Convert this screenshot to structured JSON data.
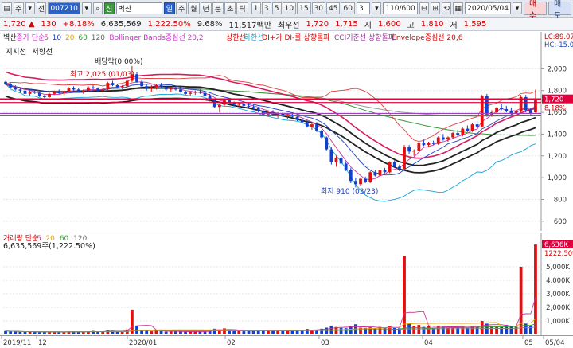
{
  "toolbar": {
    "type_label": "주",
    "mode_label": "전",
    "code": "007210",
    "search_badge": "신",
    "stock_name": "벽산",
    "period_buttons": [
      "일",
      "주",
      "월",
      "년",
      "분",
      "초",
      "틱"
    ],
    "selected_period": "일",
    "minute_buttons": [
      "1",
      "3",
      "5",
      "10",
      "15",
      "30",
      "45",
      "60"
    ],
    "custom_value": "3",
    "count": "110/600",
    "date": "2020/05/04",
    "buy_label": "매수",
    "sell_label": "매도"
  },
  "quote": {
    "price": "1,720",
    "change": "130",
    "change_pct": "+8.18%",
    "volume": "6,635,569",
    "vol_pct": "1,222.50%",
    "turnover_pct": "9.68%",
    "amount": "11,517백만",
    "best_label": "최우선",
    "best_price": "1,720",
    "best_price2": "1,715",
    "high_label": "시",
    "high": "1,600",
    "high2_label": "고",
    "high2": "1,810",
    "low_label": "저",
    "low": "1,595"
  },
  "price_legend": [
    {
      "text": "벽산",
      "color": "#222222"
    },
    {
      "text": "종가 단순",
      "color": "#cc33cc"
    },
    {
      "text": "5",
      "color": "#cc3399"
    },
    {
      "text": "10",
      "color": "#1d3fbf"
    },
    {
      "text": "20",
      "color": "#e6a000"
    },
    {
      "text": "60",
      "color": "#339933"
    },
    {
      "text": "120",
      "color": "#666666"
    },
    {
      "text": "Bollinger Bands중심선 20,2",
      "color": "#cc33cc"
    },
    {
      "text": "상한선",
      "color": "#d80000"
    },
    {
      "text": "하한선",
      "color": "#1aa3d8"
    },
    {
      "text": "DI+가 DI-를 상향돌파",
      "color": "#d80000"
    },
    {
      "text": "CCI기준선 상향돌파",
      "color": "#993399"
    },
    {
      "text": "Envelope중심선 20,6",
      "color": "#d80000"
    }
  ],
  "price_legend_line2": [
    "지지선",
    "저항선"
  ],
  "annotations": {
    "dividend": "배당락(0.00%)",
    "high_mark": "최고 2,025 (01/03)",
    "low_mark": "최저 910 (03/23)"
  },
  "price_axis": {
    "top_labels": [
      "LC:89.07%",
      "HC:-15.06%"
    ],
    "ticks": [
      "2,000",
      "1,800",
      "1,600",
      "1,400",
      "1,200",
      "1,000",
      "800",
      "600"
    ],
    "current_price": "1,720",
    "current_pct": "8.18%"
  },
  "volume_legend": [
    {
      "text": "거래량 단순",
      "color": "#d80000"
    },
    {
      "text": "5",
      "color": "#cc3399"
    },
    {
      "text": "20",
      "color": "#e6a000"
    },
    {
      "text": "60",
      "color": "#339933"
    },
    {
      "text": "120",
      "color": "#666666"
    }
  ],
  "volume_info": "6,635,569주(1,222.50%)",
  "volume_axis": {
    "ticks": [
      "5,000K",
      "4,000K",
      "3,000K",
      "2,000K",
      "1,000K"
    ],
    "current": "6,636K",
    "current_pct": "1222.50%"
  },
  "x_axis": {
    "labels": [
      "2019/11",
      "12",
      "2020/01",
      "02",
      "03",
      "04",
      "05",
      "05/04"
    ]
  },
  "chart_data": {
    "type": "candlestick",
    "ylim": [
      540,
      2120
    ],
    "ohlc": [
      [
        1880,
        1890,
        1850,
        1860
      ],
      [
        1860,
        1870,
        1820,
        1830
      ],
      [
        1830,
        1850,
        1800,
        1810
      ],
      [
        1810,
        1830,
        1780,
        1800
      ],
      [
        1800,
        1820,
        1760,
        1770
      ],
      [
        1770,
        1800,
        1750,
        1790
      ],
      [
        1790,
        1810,
        1770,
        1780
      ],
      [
        1780,
        1790,
        1740,
        1750
      ],
      [
        1750,
        1760,
        1730,
        1740
      ],
      [
        1740,
        1780,
        1735,
        1770
      ],
      [
        1770,
        1800,
        1760,
        1790
      ],
      [
        1790,
        1810,
        1770,
        1780
      ],
      [
        1780,
        1800,
        1760,
        1795
      ],
      [
        1795,
        1830,
        1790,
        1820
      ],
      [
        1820,
        1840,
        1800,
        1810
      ],
      [
        1810,
        1820,
        1780,
        1790
      ],
      [
        1790,
        1810,
        1770,
        1800
      ],
      [
        1800,
        1840,
        1795,
        1830
      ],
      [
        1830,
        1850,
        1810,
        1820
      ],
      [
        1820,
        1830,
        1790,
        1800
      ],
      [
        1800,
        1820,
        1780,
        1810
      ],
      [
        1810,
        1880,
        1800,
        1870
      ],
      [
        1870,
        1890,
        1840,
        1850
      ],
      [
        1850,
        1860,
        1820,
        1830
      ],
      [
        1830,
        1850,
        1810,
        1840
      ],
      [
        1840,
        1900,
        1830,
        1890
      ],
      [
        1890,
        2025,
        1880,
        1950
      ],
      [
        1950,
        1970,
        1870,
        1880
      ],
      [
        1880,
        1900,
        1830,
        1840
      ],
      [
        1840,
        1860,
        1800,
        1820
      ],
      [
        1820,
        1850,
        1790,
        1830
      ],
      [
        1830,
        1860,
        1810,
        1850
      ],
      [
        1850,
        1870,
        1820,
        1830
      ],
      [
        1830,
        1840,
        1800,
        1810
      ],
      [
        1810,
        1830,
        1790,
        1820
      ],
      [
        1820,
        1840,
        1800,
        1810
      ],
      [
        1810,
        1830,
        1780,
        1790
      ],
      [
        1790,
        1800,
        1760,
        1770
      ],
      [
        1770,
        1790,
        1750,
        1780
      ],
      [
        1780,
        1800,
        1760,
        1790
      ],
      [
        1790,
        1810,
        1770,
        1780
      ],
      [
        1780,
        1790,
        1740,
        1750
      ],
      [
        1750,
        1770,
        1700,
        1710
      ],
      [
        1710,
        1720,
        1640,
        1650
      ],
      [
        1650,
        1680,
        1600,
        1670
      ],
      [
        1670,
        1720,
        1660,
        1710
      ],
      [
        1710,
        1730,
        1680,
        1690
      ],
      [
        1690,
        1700,
        1660,
        1670
      ],
      [
        1670,
        1690,
        1650,
        1680
      ],
      [
        1680,
        1700,
        1650,
        1660
      ],
      [
        1660,
        1680,
        1640,
        1650
      ],
      [
        1650,
        1670,
        1620,
        1640
      ],
      [
        1640,
        1650,
        1600,
        1610
      ],
      [
        1610,
        1620,
        1570,
        1580
      ],
      [
        1580,
        1610,
        1560,
        1600
      ],
      [
        1600,
        1620,
        1570,
        1580
      ],
      [
        1580,
        1600,
        1550,
        1590
      ],
      [
        1590,
        1600,
        1560,
        1570
      ],
      [
        1570,
        1590,
        1540,
        1580
      ],
      [
        1580,
        1600,
        1550,
        1560
      ],
      [
        1560,
        1580,
        1520,
        1530
      ],
      [
        1530,
        1550,
        1500,
        1510
      ],
      [
        1510,
        1530,
        1460,
        1470
      ],
      [
        1470,
        1500,
        1440,
        1490
      ],
      [
        1490,
        1510,
        1420,
        1430
      ],
      [
        1430,
        1440,
        1360,
        1370
      ],
      [
        1370,
        1380,
        1250,
        1260
      ],
      [
        1260,
        1280,
        1120,
        1140
      ],
      [
        1140,
        1200,
        1100,
        1180
      ],
      [
        1180,
        1200,
        1120,
        1130
      ],
      [
        1130,
        1150,
        1060,
        1070
      ],
      [
        1070,
        1090,
        950,
        970
      ],
      [
        970,
        1000,
        910,
        940
      ],
      [
        940,
        1000,
        920,
        990
      ],
      [
        990,
        1010,
        950,
        960
      ],
      [
        960,
        1060,
        950,
        1050
      ],
      [
        1050,
        1070,
        1010,
        1020
      ],
      [
        1020,
        1080,
        1010,
        1070
      ],
      [
        1070,
        1090,
        1040,
        1050
      ],
      [
        1050,
        1150,
        1040,
        1140
      ],
      [
        1140,
        1160,
        1090,
        1100
      ],
      [
        1100,
        1120,
        1060,
        1080
      ],
      [
        1080,
        1300,
        1070,
        1280
      ],
      [
        1280,
        1300,
        1220,
        1240
      ],
      [
        1240,
        1260,
        1200,
        1250
      ],
      [
        1250,
        1330,
        1240,
        1320
      ],
      [
        1320,
        1350,
        1290,
        1300
      ],
      [
        1300,
        1330,
        1280,
        1320
      ],
      [
        1320,
        1340,
        1300,
        1310
      ],
      [
        1310,
        1380,
        1300,
        1370
      ],
      [
        1370,
        1400,
        1340,
        1350
      ],
      [
        1350,
        1380,
        1330,
        1370
      ],
      [
        1370,
        1420,
        1360,
        1410
      ],
      [
        1410,
        1440,
        1380,
        1390
      ],
      [
        1390,
        1460,
        1380,
        1450
      ],
      [
        1450,
        1480,
        1420,
        1430
      ],
      [
        1430,
        1500,
        1420,
        1490
      ],
      [
        1490,
        1520,
        1460,
        1470
      ],
      [
        1470,
        1760,
        1460,
        1750
      ],
      [
        1750,
        1770,
        1560,
        1580
      ],
      [
        1580,
        1620,
        1560,
        1600
      ],
      [
        1600,
        1650,
        1590,
        1640
      ],
      [
        1640,
        1680,
        1620,
        1630
      ],
      [
        1630,
        1660,
        1600,
        1610
      ],
      [
        1610,
        1640,
        1580,
        1590
      ],
      [
        1590,
        1620,
        1570,
        1610
      ],
      [
        1610,
        1760,
        1600,
        1740
      ],
      [
        1740,
        1760,
        1600,
        1620
      ],
      [
        1620,
        1640,
        1570,
        1590
      ],
      [
        1600,
        1810,
        1595,
        1720
      ]
    ],
    "volume_k": [
      250,
      230,
      210,
      180,
      200,
      190,
      170,
      160,
      150,
      180,
      200,
      190,
      170,
      210,
      220,
      180,
      170,
      230,
      260,
      200,
      190,
      300,
      280,
      220,
      200,
      360,
      1830,
      600,
      300,
      260,
      230,
      280,
      240,
      200,
      210,
      220,
      230,
      200,
      210,
      220,
      210,
      230,
      300,
      420,
      380,
      450,
      280,
      260,
      240,
      230,
      260,
      280,
      300,
      320,
      300,
      280,
      260,
      250,
      270,
      300,
      320,
      340,
      400,
      300,
      350,
      420,
      500,
      650,
      550,
      480,
      460,
      600,
      750,
      500,
      480,
      520,
      450,
      550,
      480,
      620,
      500,
      450,
      5800,
      800,
      600,
      700,
      550,
      600,
      500,
      650,
      550,
      500,
      600,
      520,
      580,
      480,
      600,
      550,
      1000,
      800,
      650,
      600,
      550,
      700,
      600,
      550,
      5000,
      800,
      650,
      6636
    ],
    "volume_ylim": [
      0,
      6700
    ],
    "support_price": 1590,
    "resistance_price": 1720
  }
}
